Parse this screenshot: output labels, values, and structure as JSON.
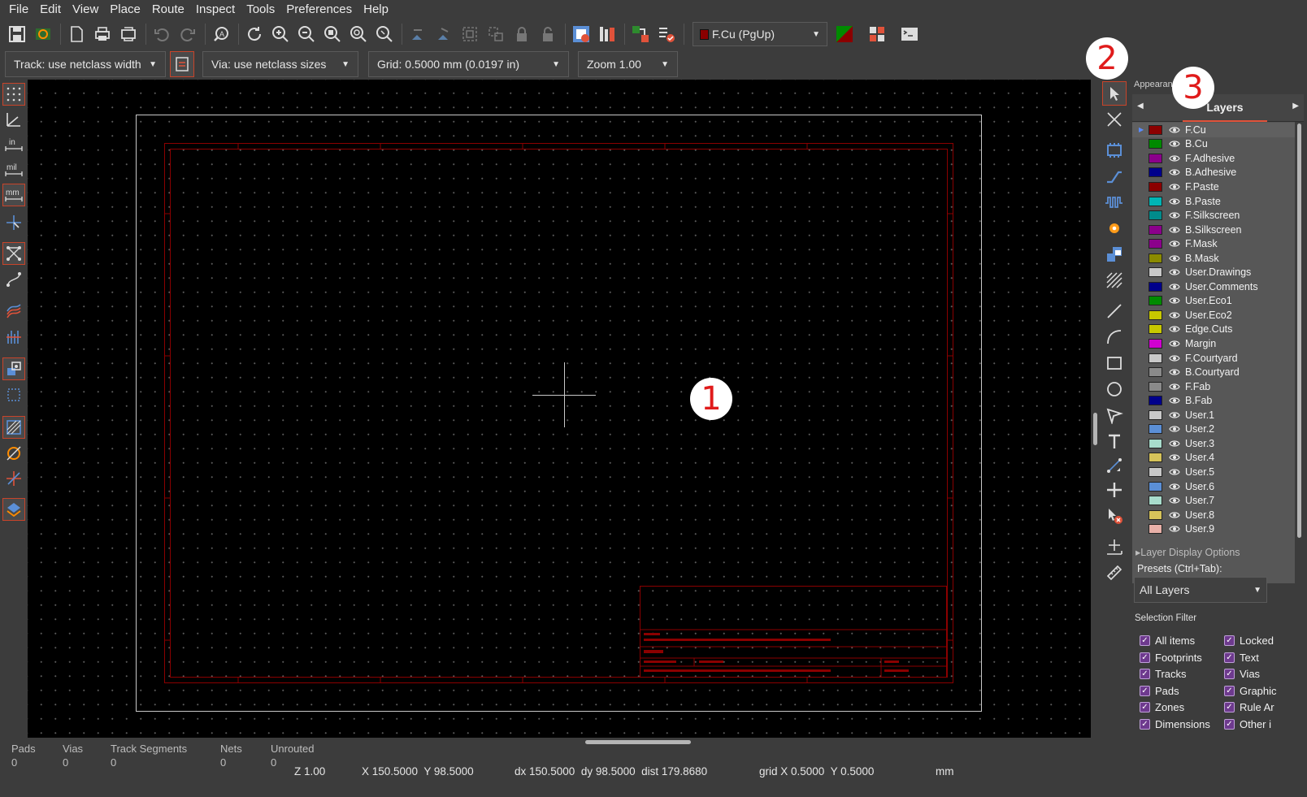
{
  "menu": [
    "File",
    "Edit",
    "View",
    "Place",
    "Route",
    "Inspect",
    "Tools",
    "Preferences",
    "Help"
  ],
  "toolbar": {
    "icons": [
      "save-icon",
      "board-setup-icon",
      "page-settings-icon",
      "print-icon",
      "plot-icon",
      "undo-icon",
      "redo-icon",
      "find-icon",
      "refresh-icon",
      "zoom-in-icon",
      "zoom-out-icon",
      "zoom-fit-icon",
      "zoom-objects-icon",
      "zoom-selection-icon",
      "rotate-ccw-icon",
      "rotate-cw-icon",
      "group-icon",
      "ungroup-icon",
      "lock-icon",
      "unlock-icon",
      "update-pcb-icon",
      "footprint-browser-icon",
      "netlist-icon",
      "drc-icon"
    ],
    "layer_dropdown": "F.Cu (PgUp)"
  },
  "toolbar2": {
    "track": "Track: use netclass width",
    "via": "Via: use netclass sizes",
    "grid": "Grid: 0.5000 mm (0.0197 in)",
    "zoom": "Zoom 1.00"
  },
  "appearance": {
    "title": "Appearance",
    "tab": "Layers",
    "layers": [
      {
        "name": "F.Cu",
        "color": "#8b0000"
      },
      {
        "name": "B.Cu",
        "color": "#008a00"
      },
      {
        "name": "F.Adhesive",
        "color": "#8b008b"
      },
      {
        "name": "B.Adhesive",
        "color": "#00008b"
      },
      {
        "name": "F.Paste",
        "color": "#8b0000"
      },
      {
        "name": "B.Paste",
        "color": "#00b5b5"
      },
      {
        "name": "F.Silkscreen",
        "color": "#008b8b"
      },
      {
        "name": "B.Silkscreen",
        "color": "#8b008b"
      },
      {
        "name": "F.Mask",
        "color": "#8b008b"
      },
      {
        "name": "B.Mask",
        "color": "#8b8b00"
      },
      {
        "name": "User.Drawings",
        "color": "#c8c8c8"
      },
      {
        "name": "User.Comments",
        "color": "#00008b"
      },
      {
        "name": "User.Eco1",
        "color": "#008b00"
      },
      {
        "name": "User.Eco2",
        "color": "#c8c800"
      },
      {
        "name": "Edge.Cuts",
        "color": "#c8c800"
      },
      {
        "name": "Margin",
        "color": "#d000d0"
      },
      {
        "name": "F.Courtyard",
        "color": "#c8c8c8"
      },
      {
        "name": "B.Courtyard",
        "color": "#8a8a8a"
      },
      {
        "name": "F.Fab",
        "color": "#8a8a8a"
      },
      {
        "name": "B.Fab",
        "color": "#00008b"
      },
      {
        "name": "User.1",
        "color": "#c8c8c8"
      },
      {
        "name": "User.2",
        "color": "#5b8fd6"
      },
      {
        "name": "User.3",
        "color": "#a8dccc"
      },
      {
        "name": "User.4",
        "color": "#d6c35a"
      },
      {
        "name": "User.5",
        "color": "#c8c8c8"
      },
      {
        "name": "User.6",
        "color": "#5b8fd6"
      },
      {
        "name": "User.7",
        "color": "#a8dccc"
      },
      {
        "name": "User.8",
        "color": "#d6c35a"
      },
      {
        "name": "User.9",
        "color": "#e8b0a8"
      }
    ],
    "layer_display_options": "Layer Display Options",
    "presets_label": "Presets (Ctrl+Tab):",
    "presets_value": "All Layers",
    "selection_filter": "Selection Filter",
    "filters": [
      {
        "label": "All items",
        "col": 0
      },
      {
        "label": "Locked",
        "col": 1
      },
      {
        "label": "Footprints",
        "col": 0
      },
      {
        "label": "Text",
        "col": 1
      },
      {
        "label": "Tracks",
        "col": 0
      },
      {
        "label": "Vias",
        "col": 1
      },
      {
        "label": "Pads",
        "col": 0
      },
      {
        "label": "Graphic",
        "col": 1
      },
      {
        "label": "Zones",
        "col": 0
      },
      {
        "label": "Rule Ar",
        "col": 1
      },
      {
        "label": "Dimensions",
        "col": 0
      },
      {
        "label": "Other i",
        "col": 1
      }
    ]
  },
  "status": {
    "pads_label": "Pads",
    "pads_value": "0",
    "vias_label": "Vias",
    "vias_value": "0",
    "tracks_label": "Track Segments",
    "tracks_value": "0",
    "nets_label": "Nets",
    "nets_value": "0",
    "unrouted_label": "Unrouted",
    "unrouted_value": "0"
  },
  "bottom": {
    "z": "Z 1.00",
    "xy": "X 150.5000  Y 98.5000",
    "dxy": "dx 150.5000  dy 98.5000  dist 179.8680",
    "grid": "grid X 0.5000  Y 0.5000",
    "units": "mm"
  },
  "annotations": [
    "1",
    "2",
    "3"
  ]
}
